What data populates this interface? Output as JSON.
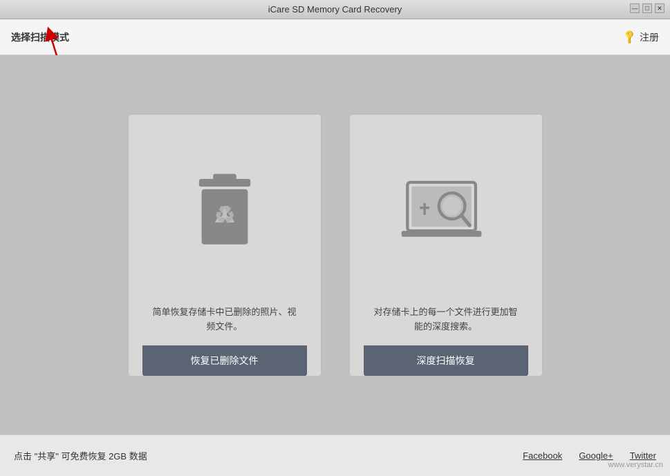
{
  "titleBar": {
    "title": "iCare SD Memory Card Recovery",
    "minBtn": "—",
    "maxBtn": "□",
    "closeBtn": "✕"
  },
  "toolbar": {
    "label": "选择扫描模式",
    "registerLabel": "注册"
  },
  "cards": [
    {
      "id": "recover-deleted",
      "description": "简单恢复存储卡中已删除的照片、视频文件。",
      "buttonLabel": "恢复已删除文件"
    },
    {
      "id": "deep-scan",
      "description": "对存储卡上的每一个文件进行更加智能的深度搜索。",
      "buttonLabel": "深度扫描恢复"
    }
  ],
  "bottomBar": {
    "text": "点击 \"共享\" 可免费恢复 2GB 数据",
    "links": [
      "Facebook",
      "Google+",
      "Twitter"
    ]
  },
  "watermark": "www.verystar.cn"
}
